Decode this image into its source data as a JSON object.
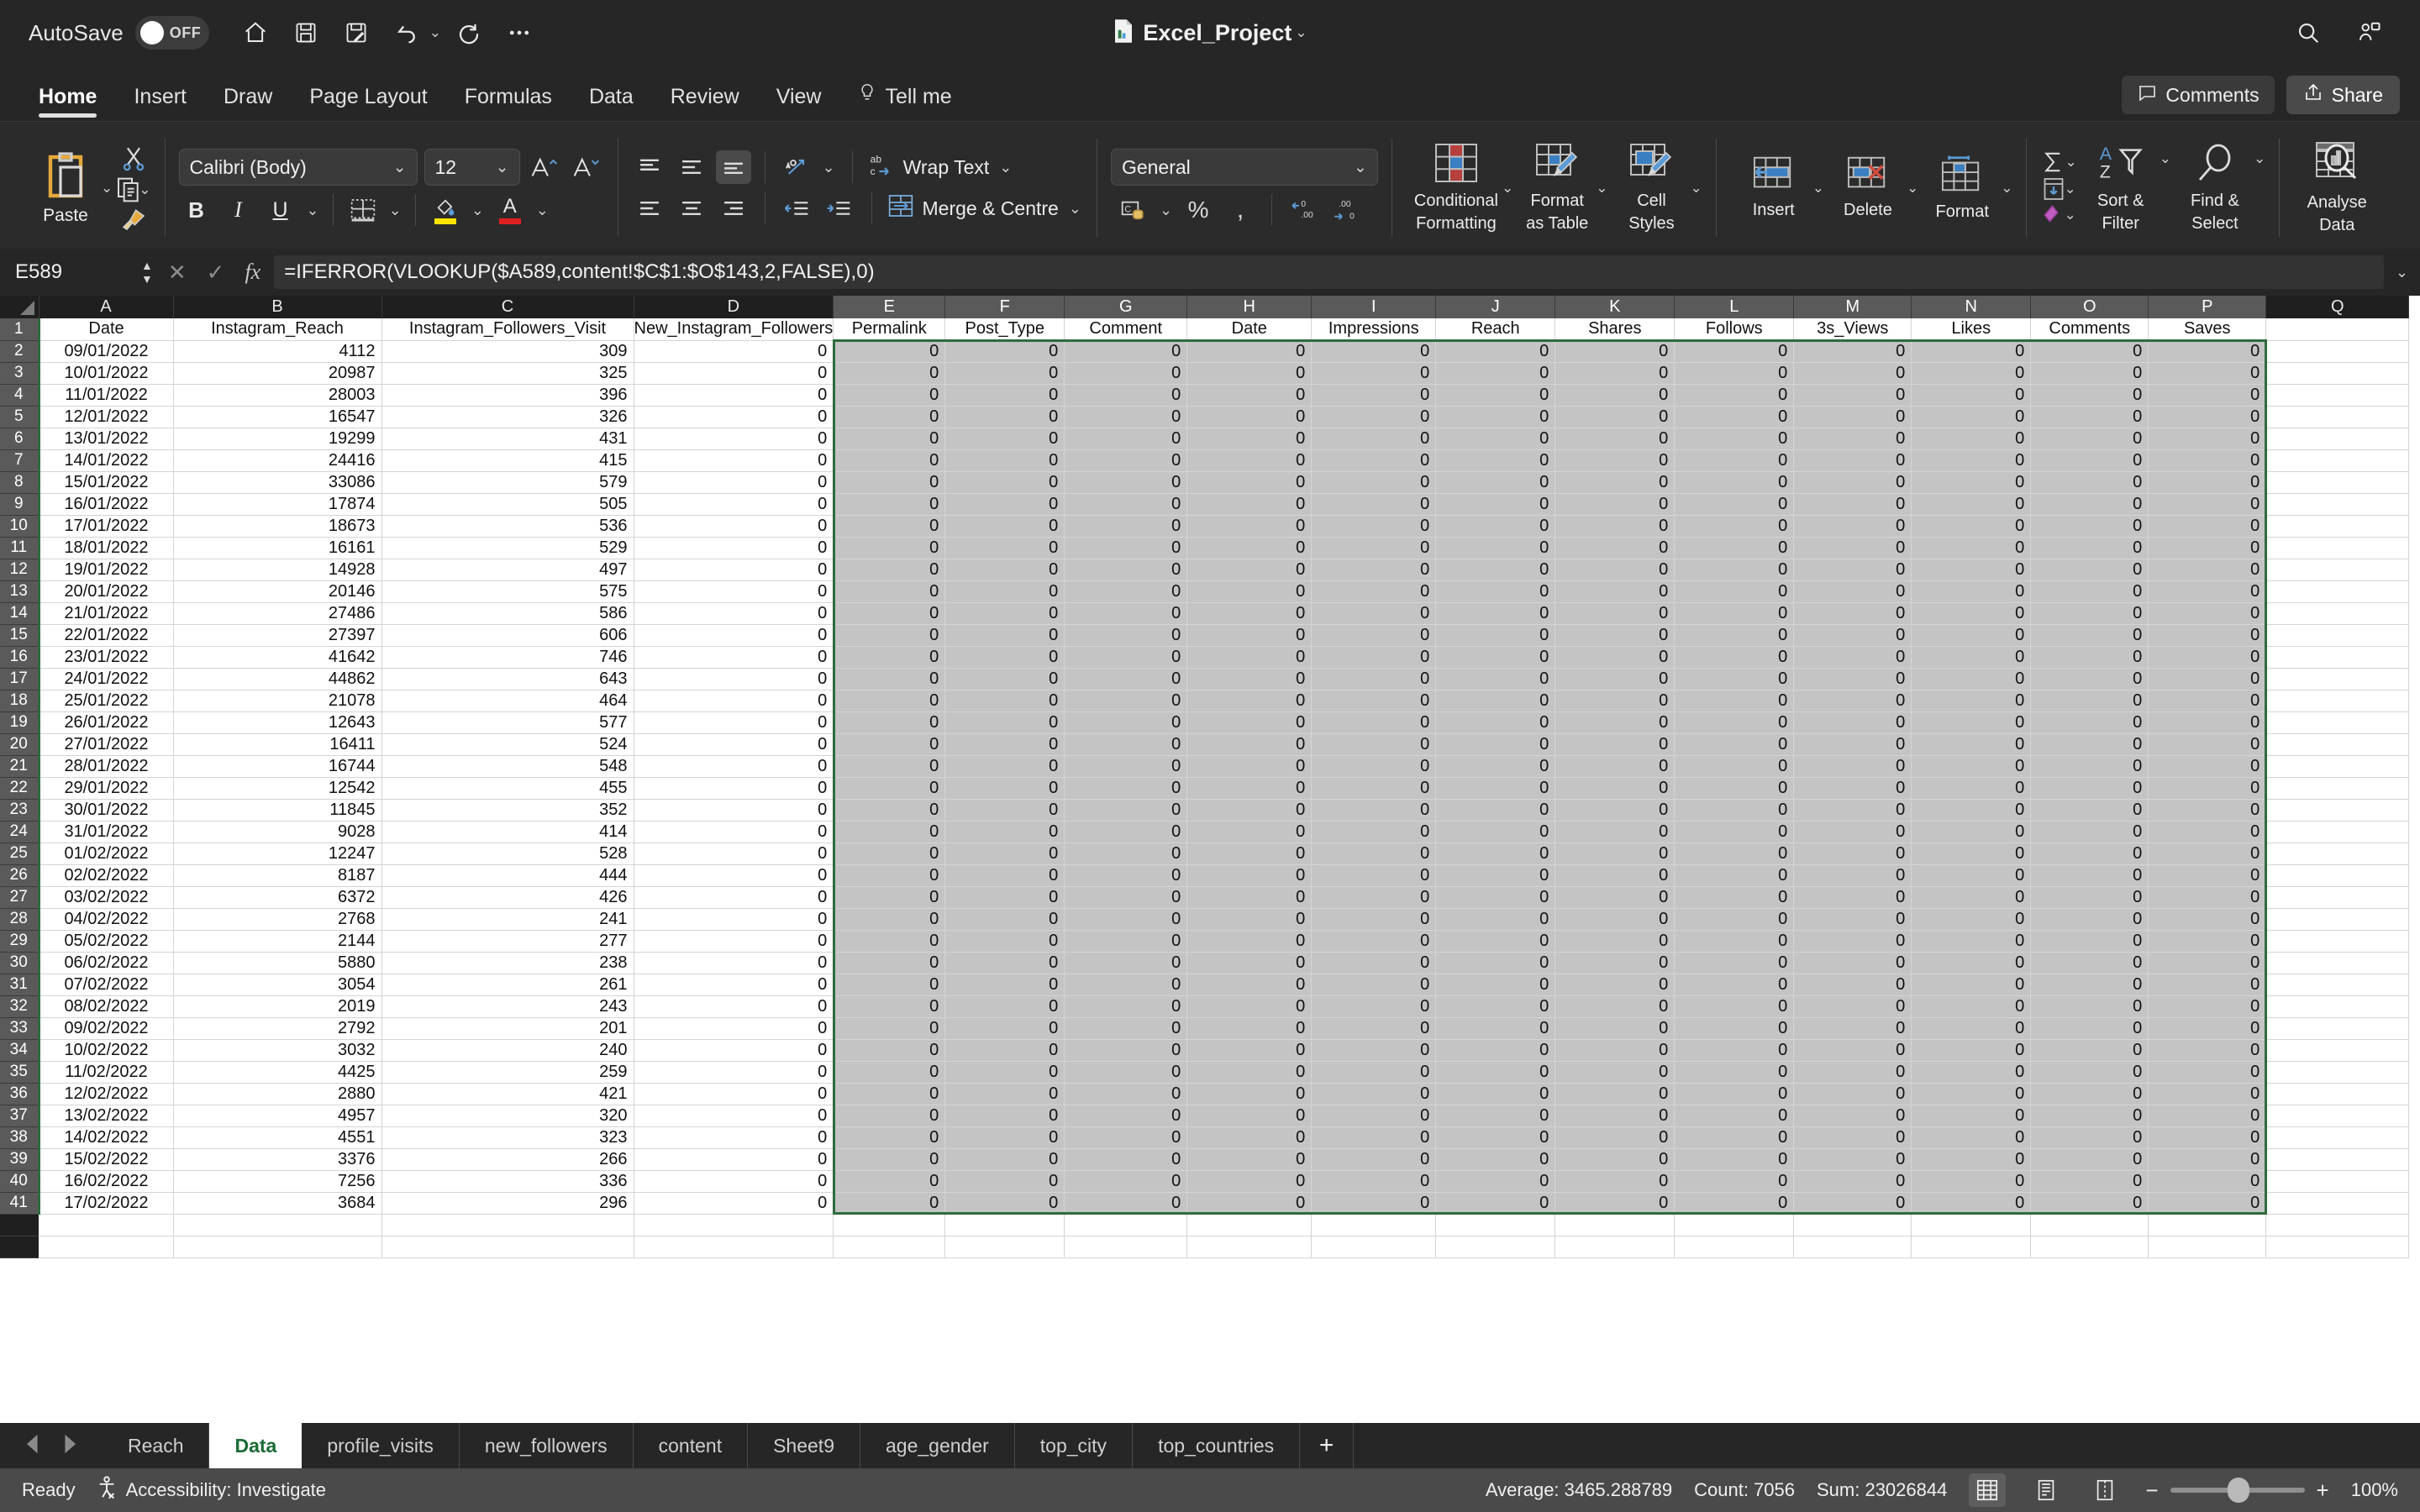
{
  "titlebar": {
    "autosave_label": "AutoSave",
    "autosave_state": "OFF",
    "doc_title": "Excel_Project",
    "quick_access": [
      {
        "name": "home-icon",
        "label": "Home"
      },
      {
        "name": "save-icon",
        "label": "Save"
      },
      {
        "name": "save-as-icon",
        "label": "Save As"
      },
      {
        "name": "undo-icon",
        "label": "Undo"
      },
      {
        "name": "redo-icon",
        "label": "Redo"
      },
      {
        "name": "more-icon",
        "label": "More"
      }
    ],
    "search_label": "Search",
    "account_label": "Account"
  },
  "ribbon": {
    "tabs": [
      {
        "label": "Home",
        "active": true
      },
      {
        "label": "Insert",
        "active": false
      },
      {
        "label": "Draw",
        "active": false
      },
      {
        "label": "Page Layout",
        "active": false
      },
      {
        "label": "Formulas",
        "active": false
      },
      {
        "label": "Data",
        "active": false
      },
      {
        "label": "Review",
        "active": false
      },
      {
        "label": "View",
        "active": false
      },
      {
        "label": "Tell me",
        "active": false
      }
    ],
    "comments_label": "Comments",
    "share_label": "Share",
    "clipboard": {
      "paste_label": "Paste",
      "cut_label": "Cut",
      "copy_label": "Copy",
      "format_painter_label": "Format Painter"
    },
    "font": {
      "family_value": "Calibri (Body)",
      "size_value": "12",
      "grow_label": "Increase Font Size",
      "shrink_label": "Decrease Font Size",
      "bold_label": "B",
      "italic_label": "I",
      "underline_label": "U",
      "borders_label": "Borders",
      "fill_color_label": "Fill Color",
      "font_color_label": "Font Color",
      "fill_color": "#ffe400",
      "font_color": "#e02020"
    },
    "alignment": {
      "wrap_text_label": "Wrap Text",
      "merge_label": "Merge & Centre",
      "orientation_label": "Orientation",
      "decrease_indent_label": "Decrease Indent",
      "increase_indent_label": "Increase Indent"
    },
    "number": {
      "format_value": "General",
      "accounting_label": "Accounting Number Format",
      "percent_label": "%",
      "comma_label": "Comma Style",
      "increase_dec_label": "Increase Decimal",
      "decrease_dec_label": "Decrease Decimal"
    },
    "styles": {
      "conditional_line1": "Conditional",
      "conditional_line2": "Formatting",
      "table_line1": "Format",
      "table_line2": "as Table",
      "cell_line1": "Cell",
      "cell_line2": "Styles"
    },
    "cells": {
      "insert_label": "Insert",
      "delete_label": "Delete",
      "format_label": "Format"
    },
    "editing": {
      "autosum_label": "AutoSum",
      "fill_label": "Fill",
      "clear_label": "Clear",
      "sort_line1": "Sort &",
      "sort_line2": "Filter",
      "find_line1": "Find &",
      "find_line2": "Select"
    },
    "analyse": {
      "line1": "Analyse",
      "line2": "Data"
    }
  },
  "formula_bar": {
    "name_box": "E589",
    "cancel_label": "Cancel",
    "enter_label": "Enter",
    "fx_label": "fx",
    "formula": "=IFERROR(VLOOKUP($A589,content!$C$1:$O$143,2,FALSE),0)"
  },
  "grid": {
    "column_letters": [
      "A",
      "B",
      "C",
      "D",
      "E",
      "F",
      "G",
      "H",
      "I",
      "J",
      "K",
      "L",
      "M",
      "N",
      "O",
      "P",
      "Q"
    ],
    "selected_columns": [
      "E",
      "F",
      "G",
      "H",
      "I",
      "J",
      "K",
      "L",
      "M",
      "N",
      "O",
      "P"
    ],
    "headers": [
      "Date",
      "Instagram_Reach",
      "Instagram_Followers_Visit",
      "New_Instagram_Followers",
      "Permalink",
      "Post_Type",
      "Comment",
      "Date",
      "Impressions",
      "Reach",
      "Shares",
      "Follows",
      "3s_Views",
      "Likes",
      "Comments",
      "Saves"
    ],
    "row_numbers": [
      1,
      2,
      3,
      4,
      5,
      6,
      7,
      8,
      9,
      10,
      11,
      12,
      13,
      14,
      15,
      16,
      17,
      18,
      19,
      20,
      21,
      22,
      23,
      24,
      25,
      26,
      27,
      28,
      29,
      30,
      31,
      32,
      33,
      34,
      35,
      36,
      37,
      38,
      39,
      40,
      41
    ],
    "rows": [
      {
        "n": 2,
        "date": "09/01/2022",
        "reach": "4112",
        "visit": "309",
        "newf": "0"
      },
      {
        "n": 3,
        "date": "10/01/2022",
        "reach": "20987",
        "visit": "325",
        "newf": "0"
      },
      {
        "n": 4,
        "date": "11/01/2022",
        "reach": "28003",
        "visit": "396",
        "newf": "0"
      },
      {
        "n": 5,
        "date": "12/01/2022",
        "reach": "16547",
        "visit": "326",
        "newf": "0"
      },
      {
        "n": 6,
        "date": "13/01/2022",
        "reach": "19299",
        "visit": "431",
        "newf": "0"
      },
      {
        "n": 7,
        "date": "14/01/2022",
        "reach": "24416",
        "visit": "415",
        "newf": "0"
      },
      {
        "n": 8,
        "date": "15/01/2022",
        "reach": "33086",
        "visit": "579",
        "newf": "0"
      },
      {
        "n": 9,
        "date": "16/01/2022",
        "reach": "17874",
        "visit": "505",
        "newf": "0"
      },
      {
        "n": 10,
        "date": "17/01/2022",
        "reach": "18673",
        "visit": "536",
        "newf": "0"
      },
      {
        "n": 11,
        "date": "18/01/2022",
        "reach": "16161",
        "visit": "529",
        "newf": "0"
      },
      {
        "n": 12,
        "date": "19/01/2022",
        "reach": "14928",
        "visit": "497",
        "newf": "0"
      },
      {
        "n": 13,
        "date": "20/01/2022",
        "reach": "20146",
        "visit": "575",
        "newf": "0"
      },
      {
        "n": 14,
        "date": "21/01/2022",
        "reach": "27486",
        "visit": "586",
        "newf": "0"
      },
      {
        "n": 15,
        "date": "22/01/2022",
        "reach": "27397",
        "visit": "606",
        "newf": "0"
      },
      {
        "n": 16,
        "date": "23/01/2022",
        "reach": "41642",
        "visit": "746",
        "newf": "0"
      },
      {
        "n": 17,
        "date": "24/01/2022",
        "reach": "44862",
        "visit": "643",
        "newf": "0"
      },
      {
        "n": 18,
        "date": "25/01/2022",
        "reach": "21078",
        "visit": "464",
        "newf": "0"
      },
      {
        "n": 19,
        "date": "26/01/2022",
        "reach": "12643",
        "visit": "577",
        "newf": "0"
      },
      {
        "n": 20,
        "date": "27/01/2022",
        "reach": "16411",
        "visit": "524",
        "newf": "0"
      },
      {
        "n": 21,
        "date": "28/01/2022",
        "reach": "16744",
        "visit": "548",
        "newf": "0"
      },
      {
        "n": 22,
        "date": "29/01/2022",
        "reach": "12542",
        "visit": "455",
        "newf": "0"
      },
      {
        "n": 23,
        "date": "30/01/2022",
        "reach": "11845",
        "visit": "352",
        "newf": "0"
      },
      {
        "n": 24,
        "date": "31/01/2022",
        "reach": "9028",
        "visit": "414",
        "newf": "0"
      },
      {
        "n": 25,
        "date": "01/02/2022",
        "reach": "12247",
        "visit": "528",
        "newf": "0"
      },
      {
        "n": 26,
        "date": "02/02/2022",
        "reach": "8187",
        "visit": "444",
        "newf": "0"
      },
      {
        "n": 27,
        "date": "03/02/2022",
        "reach": "6372",
        "visit": "426",
        "newf": "0"
      },
      {
        "n": 28,
        "date": "04/02/2022",
        "reach": "2768",
        "visit": "241",
        "newf": "0"
      },
      {
        "n": 29,
        "date": "05/02/2022",
        "reach": "2144",
        "visit": "277",
        "newf": "0"
      },
      {
        "n": 30,
        "date": "06/02/2022",
        "reach": "5880",
        "visit": "238",
        "newf": "0"
      },
      {
        "n": 31,
        "date": "07/02/2022",
        "reach": "3054",
        "visit": "261",
        "newf": "0"
      },
      {
        "n": 32,
        "date": "08/02/2022",
        "reach": "2019",
        "visit": "243",
        "newf": "0"
      },
      {
        "n": 33,
        "date": "09/02/2022",
        "reach": "2792",
        "visit": "201",
        "newf": "0"
      },
      {
        "n": 34,
        "date": "10/02/2022",
        "reach": "3032",
        "visit": "240",
        "newf": "0"
      },
      {
        "n": 35,
        "date": "11/02/2022",
        "reach": "4425",
        "visit": "259",
        "newf": "0"
      },
      {
        "n": 36,
        "date": "12/02/2022",
        "reach": "2880",
        "visit": "421",
        "newf": "0"
      },
      {
        "n": 37,
        "date": "13/02/2022",
        "reach": "4957",
        "visit": "320",
        "newf": "0"
      },
      {
        "n": 38,
        "date": "14/02/2022",
        "reach": "4551",
        "visit": "323",
        "newf": "0"
      },
      {
        "n": 39,
        "date": "15/02/2022",
        "reach": "3376",
        "visit": "266",
        "newf": "0"
      },
      {
        "n": 40,
        "date": "16/02/2022",
        "reach": "7256",
        "visit": "336",
        "newf": "0"
      },
      {
        "n": 41,
        "date": "17/02/2022",
        "reach": "3684",
        "visit": "296",
        "newf": "0"
      }
    ],
    "selected_cell_value": "0",
    "selection_range": "E2:P41"
  },
  "sheet_tabs": [
    {
      "label": "Reach",
      "active": false
    },
    {
      "label": "Data",
      "active": true
    },
    {
      "label": "profile_visits",
      "active": false
    },
    {
      "label": "new_followers",
      "active": false
    },
    {
      "label": "content",
      "active": false
    },
    {
      "label": "Sheet9",
      "active": false
    },
    {
      "label": "age_gender",
      "active": false
    },
    {
      "label": "top_city",
      "active": false
    },
    {
      "label": "top_countries",
      "active": false
    }
  ],
  "sheet_nav": {
    "prev_label": "Previous Sheet",
    "next_label": "Next Sheet",
    "add_label": "+"
  },
  "status_bar": {
    "mode": "Ready",
    "accessibility": "Accessibility: Investigate",
    "average": "Average: 3465.288789",
    "count": "Count: 7056",
    "sum": "Sum: 23026844",
    "zoom": "100%",
    "normal_view_label": "Normal View",
    "layout_view_label": "Page Layout View",
    "break_view_label": "Page Break Preview",
    "zoom_out_label": "−",
    "zoom_in_label": "+"
  },
  "colors": {
    "selection_green": "#2f6b3e",
    "tab_active_text": "#1b6b36",
    "accent_blue": "#2d7fd3"
  }
}
